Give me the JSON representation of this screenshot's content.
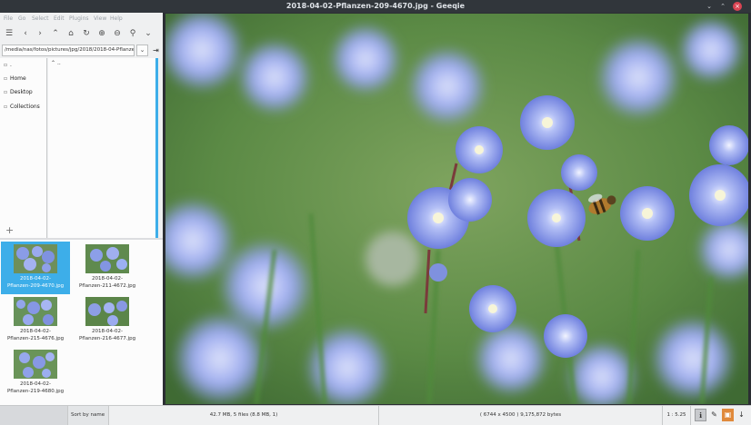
{
  "window": {
    "title": "2018-04-02-Pflanzen-209-4670.jpg - Geeqie"
  },
  "menu": [
    "File",
    "Go",
    "Select",
    "Edit",
    "Plugins",
    "View",
    "Help"
  ],
  "path": {
    "value": "/media/nas/fotos/pictures/jpg/2018/2018-04-Pflanze"
  },
  "bookmarks": [
    {
      "label": "."
    },
    {
      "label": "Home"
    },
    {
      "label": "Desktop"
    },
    {
      "label": "Collections"
    }
  ],
  "dirlist": {
    "first": ".."
  },
  "thumbnails": [
    {
      "caption1": "2018-04-02-",
      "caption2": "Pflanzen-209-4670.jpg",
      "selected": true
    },
    {
      "caption1": "2018-04-02-",
      "caption2": "Pflanzen-211-4672.jpg",
      "selected": false
    },
    {
      "caption1": "2018-04-02-",
      "caption2": "Pflanzen-215-4676.jpg",
      "selected": false
    },
    {
      "caption1": "2018-04-02-",
      "caption2": "Pflanzen-216-4677.jpg",
      "selected": false
    },
    {
      "caption1": "2018-04-02-",
      "caption2": "Pflanzen-219-4680.jpg",
      "selected": false
    }
  ],
  "status": {
    "sort": "Sort by name",
    "files": "42.7 MB, 5 files (8.8 MB, 1)",
    "image_info": "( 6744 x 4500 ) 9,175,872 bytes",
    "zoom": "1 : 5.25"
  },
  "colors": {
    "accent": "#3daee9",
    "titlebar": "#31363b",
    "close": "#da4453"
  }
}
